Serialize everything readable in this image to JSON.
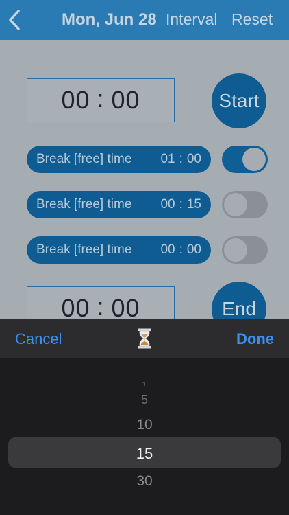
{
  "header": {
    "date": "Mon, Jun 28",
    "interval_label": "Interval",
    "reset_label": "Reset"
  },
  "main": {
    "start_time": {
      "hours": "00",
      "minutes": "00"
    },
    "start_label": "Start",
    "breaks": [
      {
        "label": "Break [free] time",
        "hours": "01",
        "minutes": "00",
        "enabled": true
      },
      {
        "label": "Break [free] time",
        "hours": "00",
        "minutes": "15",
        "enabled": false
      },
      {
        "label": "Break [free] time",
        "hours": "00",
        "minutes": "00",
        "enabled": false
      }
    ],
    "end_time": {
      "hours": "00",
      "minutes": "00"
    },
    "end_label": "End"
  },
  "picker": {
    "cancel_label": "Cancel",
    "done_label": "Done",
    "options": [
      "1",
      "5",
      "10",
      "15",
      "30"
    ],
    "selected": "15"
  },
  "colors": {
    "header_bg": "#2a7bb4",
    "accent_blue": "#0e5c92",
    "picker_action": "#3a8ff0"
  },
  "icons": {
    "back": "chevron-left-icon",
    "hourglass": "hourglass-icon"
  }
}
